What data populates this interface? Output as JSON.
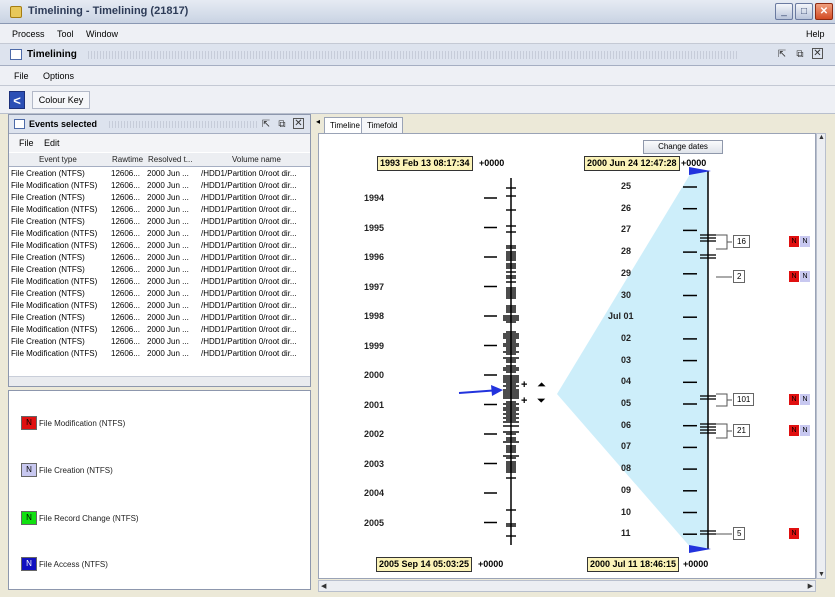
{
  "window": {
    "title": "Timelining - Timelining (21817)",
    "controls": [
      "minimize",
      "maximize",
      "close"
    ]
  },
  "menubar": {
    "items": [
      "Process",
      "Tool",
      "Window"
    ],
    "help": "Help"
  },
  "frame": {
    "title": "Timelining"
  },
  "submenu": {
    "items": [
      "File",
      "Options"
    ]
  },
  "toolbar": {
    "back_icon": "chevron-left",
    "colour_key_label": "Colour Key"
  },
  "events_panel": {
    "title": "Events selected",
    "menu": [
      "File",
      "Edit"
    ],
    "columns": [
      "Event type",
      "Rawtime",
      "Resolved t...",
      "Volume name"
    ],
    "rows": [
      [
        "File Creation (NTFS)",
        "12606...",
        "2000 Jun ...",
        "/HDD1/Partition 0/root dir..."
      ],
      [
        "File Modification (NTFS)",
        "12606...",
        "2000 Jun ...",
        "/HDD1/Partition 0/root dir..."
      ],
      [
        "File Creation (NTFS)",
        "12606...",
        "2000 Jun ...",
        "/HDD1/Partition 0/root dir..."
      ],
      [
        "File Modification (NTFS)",
        "12606...",
        "2000 Jun ...",
        "/HDD1/Partition 0/root dir..."
      ],
      [
        "File Creation (NTFS)",
        "12606...",
        "2000 Jun ...",
        "/HDD1/Partition 0/root dir..."
      ],
      [
        "File Modification (NTFS)",
        "12606...",
        "2000 Jun ...",
        "/HDD1/Partition 0/root dir..."
      ],
      [
        "File Modification (NTFS)",
        "12606...",
        "2000 Jun ...",
        "/HDD1/Partition 0/root dir..."
      ],
      [
        "File Creation (NTFS)",
        "12606...",
        "2000 Jun ...",
        "/HDD1/Partition 0/root dir..."
      ],
      [
        "File Creation (NTFS)",
        "12606...",
        "2000 Jun ...",
        "/HDD1/Partition 0/root dir..."
      ],
      [
        "File Modification (NTFS)",
        "12606...",
        "2000 Jun ...",
        "/HDD1/Partition 0/root dir..."
      ],
      [
        "File Creation (NTFS)",
        "12606...",
        "2000 Jun ...",
        "/HDD1/Partition 0/root dir..."
      ],
      [
        "File Modification (NTFS)",
        "12606...",
        "2000 Jun ...",
        "/HDD1/Partition 0/root dir..."
      ],
      [
        "File Creation (NTFS)",
        "12606...",
        "2000 Jun ...",
        "/HDD1/Partition 0/root dir..."
      ],
      [
        "File Modification (NTFS)",
        "12606...",
        "2000 Jun ...",
        "/HDD1/Partition 0/root dir..."
      ],
      [
        "File Creation (NTFS)",
        "12606...",
        "2000 Jun ...",
        "/HDD1/Partition 0/root dir..."
      ],
      [
        "File Modification (NTFS)",
        "12606...",
        "2000 Jun ...",
        "/HDD1/Partition 0/root dir..."
      ]
    ]
  },
  "colour_key": {
    "items": [
      {
        "label": "File Modification (NTFS)",
        "color": "#e01010",
        "letter": "N"
      },
      {
        "label": "File Creation (NTFS)",
        "color": "#c8c8f0",
        "letter": "N"
      },
      {
        "label": "File Record Change (NTFS)",
        "color": "#10e010",
        "letter": "N"
      },
      {
        "label": "File Access (NTFS)",
        "color": "#1010c0",
        "letter": "N"
      }
    ]
  },
  "timeline": {
    "tabs": [
      "Timeline",
      "Timefold"
    ],
    "change_dates_label": "Change dates",
    "timezone": "+0000",
    "left_start_date": "1993 Feb 13 08:17:34",
    "left_end_date": "2005 Sep 14 05:03:25",
    "right_start_date": "2000 Jun 24 12:47:28",
    "right_end_date": "2000 Jul 11 18:46:15",
    "years": [
      "1994",
      "1995",
      "1996",
      "1997",
      "1998",
      "1999",
      "2000",
      "2001",
      "2002",
      "2003",
      "2004",
      "2005"
    ],
    "days": [
      "25",
      "26",
      "27",
      "28",
      "29",
      "30",
      "Jul 01",
      "02",
      "03",
      "04",
      "05",
      "06",
      "07",
      "08",
      "09",
      "10",
      "11"
    ],
    "zoom_in_label": "+",
    "zoom_out_label": "+",
    "clusters": [
      {
        "count": "16",
        "flags": [
          "N",
          "N"
        ],
        "colors": [
          "#e01010",
          "#c8c8f0"
        ]
      },
      {
        "count": "2",
        "flags": [
          "N",
          "N"
        ],
        "colors": [
          "#e01010",
          "#c8c8f0"
        ]
      },
      {
        "count": "101",
        "flags": [
          "N",
          "N"
        ],
        "colors": [
          "#e01010",
          "#c8c8f0"
        ]
      },
      {
        "count": "21",
        "flags": [
          "N",
          "N"
        ],
        "colors": [
          "#e01010",
          "#c8c8f0"
        ]
      },
      {
        "count": "5",
        "flags": [
          "N"
        ],
        "colors": [
          "#e01010"
        ]
      }
    ],
    "accent_color": "#2233dd",
    "fold_color": "#cdeefa"
  }
}
